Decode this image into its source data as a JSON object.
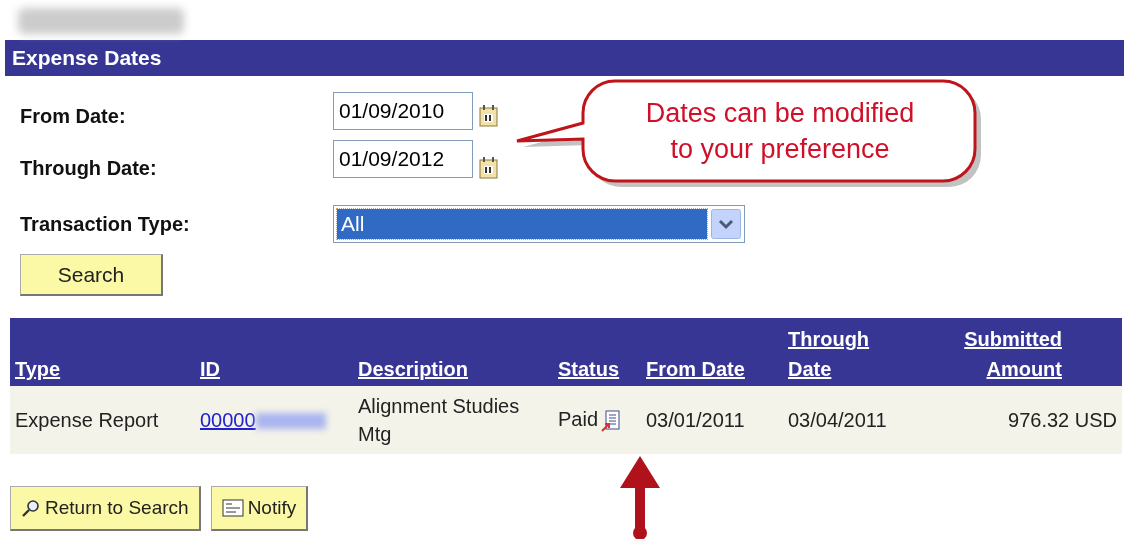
{
  "section_title": "Expense Dates",
  "fields": [
    {
      "label": "From Date:",
      "value": "01/09/2010",
      "kind": "date"
    },
    {
      "label": "Through Date:",
      "value": "01/09/2012",
      "kind": "date"
    },
    {
      "label": "Transaction Type:",
      "value": "All",
      "kind": "select"
    }
  ],
  "search_button": "Search",
  "callout": {
    "lines": [
      "Dates can be modified",
      "to your preference"
    ]
  },
  "table": {
    "columns": [
      "Type",
      "ID",
      "Description",
      "Status",
      "From Date",
      "Through Date",
      "Submitted Amount"
    ],
    "rows": [
      {
        "type": "Expense Report",
        "id": "00000",
        "description": "Alignment Studies Mtg",
        "status": "Paid",
        "from_date": "03/01/2011",
        "through_date": "03/04/2011",
        "amount": "976.32 USD"
      }
    ]
  },
  "buttons": [
    {
      "label": "Return to Search",
      "kind": "search"
    },
    {
      "label": "Notify",
      "kind": "notify"
    }
  ]
}
